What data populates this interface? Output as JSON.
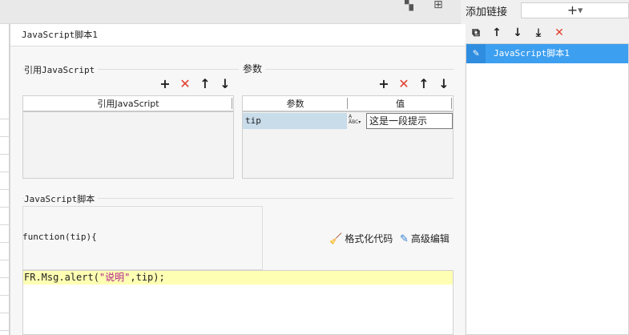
{
  "dialog": {
    "title": "JavaScript脚本1"
  },
  "ref_js": {
    "section_title": "引用JavaScript",
    "column_header": "引用JavaScript"
  },
  "params": {
    "section_title": "参数",
    "columns": [
      "参数",
      "值"
    ],
    "rows": [
      {
        "name": "tip",
        "type_icon": "abc-text-type-icon",
        "value": "这是一段提示"
      }
    ]
  },
  "script": {
    "section_title": "JavaScript脚本",
    "header_line": "function(tip){",
    "format_label": "格式化代码",
    "advanced_label": "高级编辑",
    "code_prefix": "FR.Msg.alert(",
    "code_string": "\"说明\"",
    "code_suffix": ",tip);"
  },
  "right_panel": {
    "title": "添加链接",
    "list_items": [
      "JavaScript脚本1"
    ]
  },
  "colors": {
    "accent_blue": "#3d9ff0",
    "delete_red": "#e23c2c",
    "code_highlight": "#ffffb3",
    "string_purple": "#b0208a",
    "param_row_bg": "#c8dcea"
  }
}
